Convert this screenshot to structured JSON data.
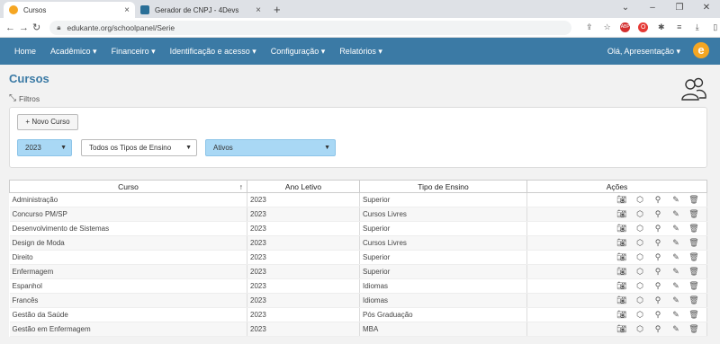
{
  "browser": {
    "tabs": [
      {
        "title": "Cursos",
        "active": true,
        "favicon_color": "#f5a623"
      },
      {
        "title": "Gerador de CNPJ - 4Devs",
        "active": false,
        "favicon_color": "#2a6f97"
      }
    ],
    "url": "edukante.org/schoolpanel/Serie"
  },
  "nav": {
    "items": [
      "Home",
      "Acadêmico",
      "Financeiro",
      "Identificação e acesso",
      "Configuração",
      "Relatórios"
    ],
    "user": "Olá, Apresentação",
    "logo_letter": "e"
  },
  "page": {
    "title": "Cursos",
    "filters_label": "Filtros",
    "new_button": "+ Novo Curso",
    "year_select": "2023",
    "type_select": "Todos os Tipos de Ensino",
    "status_select": "Ativos"
  },
  "table": {
    "headers": [
      "Curso",
      "Ano Letivo",
      "Tipo de Ensino",
      "Ações"
    ],
    "rows": [
      [
        "Administração",
        "2023",
        "Superior"
      ],
      [
        "Concurso PM/SP",
        "2023",
        "Cursos Livres"
      ],
      [
        "Desenvolvimento de Sistemas",
        "2023",
        "Superior"
      ],
      [
        "Design de Moda",
        "2023",
        "Cursos Livres"
      ],
      [
        "Direito",
        "2023",
        "Superior"
      ],
      [
        "Enfermagem",
        "2023",
        "Superior"
      ],
      [
        "Espanhol",
        "2023",
        "Idiomas"
      ],
      [
        "Francês",
        "2023",
        "Idiomas"
      ],
      [
        "Gestão da Saúde",
        "2023",
        "Pós Graduação"
      ],
      [
        "Gestão em Enfermagem",
        "2023",
        "MBA"
      ]
    ]
  },
  "colors": {
    "nav": "#3b7aa5",
    "accent": "#f5a623",
    "select_blue": "#a9d8f5"
  }
}
